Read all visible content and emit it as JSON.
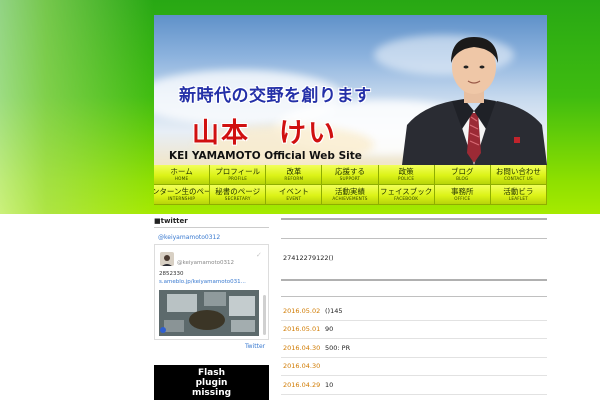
{
  "header": {
    "tagline": "新時代の交野を創ります",
    "name_jp": "山本　けい",
    "name_en": "KEI YAMAMOTO Official Web Site"
  },
  "nav": {
    "items": [
      {
        "jp": "ホーム",
        "en": "HOME"
      },
      {
        "jp": "プロフィール",
        "en": "PROFILE"
      },
      {
        "jp": "改革",
        "en": "REFORM"
      },
      {
        "jp": "応援する",
        "en": "SUPPORT"
      },
      {
        "jp": "政策",
        "en": "POLICE"
      },
      {
        "jp": "ブログ",
        "en": "BLOG"
      },
      {
        "jp": "お問い合わせ",
        "en": "CONTACT US"
      },
      {
        "jp": "インターン生のページ",
        "en": "INTERNSHIP"
      },
      {
        "jp": "秘書のページ",
        "en": "SECRETARY"
      },
      {
        "jp": "イベント",
        "en": "EVENT"
      },
      {
        "jp": "活動実績",
        "en": "ACHIEVEMENTS"
      },
      {
        "jp": "フェイスブック",
        "en": "FACEBOOK"
      },
      {
        "jp": "事務所",
        "en": "OFFICE"
      },
      {
        "jp": "活動ビラ",
        "en": "LEAFLET"
      }
    ]
  },
  "sidebar": {
    "title": "■twitter",
    "handle_link": "@keiyamamoto0312",
    "widget": {
      "user": "@keiyamamoto0312",
      "text_line1": "2852330",
      "text_line2": "s.ameblo.jp/keiyamamoto031..."
    },
    "footer_link": "Twitter",
    "flash_text": "Flash plugin missing"
  },
  "main": {
    "id_text": "27412279122()",
    "news": [
      {
        "date": "2016.05.02",
        "title": "()145"
      },
      {
        "date": "2016.05.01",
        "title": "90"
      },
      {
        "date": "2016.04.30",
        "title": "500: PR"
      },
      {
        "date": "2016.04.30",
        "title": ""
      },
      {
        "date": "2016.04.29",
        "title": "10"
      }
    ]
  },
  "colors": {
    "green_band_top": "#28a814",
    "green_band_bottom": "#a6ea00",
    "nav_yellow": "#dcf317",
    "name_red": "#d01010",
    "tagline_blue": "#2430a8",
    "date_orange": "#d07a00",
    "link_blue": "#3a7ad0"
  }
}
